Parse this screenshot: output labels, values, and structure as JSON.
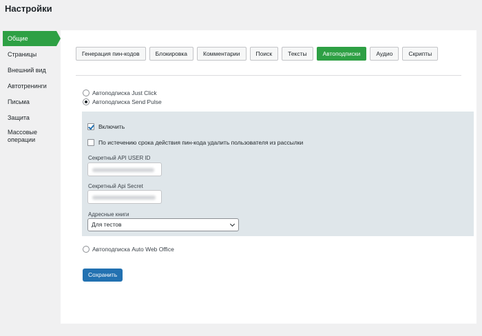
{
  "page": {
    "title": "Настройки"
  },
  "sidebar": {
    "items": [
      {
        "label": "Общие",
        "active": true
      },
      {
        "label": "Страницы"
      },
      {
        "label": "Внешний вид"
      },
      {
        "label": "Автотренинги"
      },
      {
        "label": "Письма"
      },
      {
        "label": "Защита"
      },
      {
        "label": "Массовые операции"
      }
    ]
  },
  "tabs": [
    {
      "label": "Генерация пин-кодов"
    },
    {
      "label": "Блокировка"
    },
    {
      "label": "Комментарии"
    },
    {
      "label": "Поиск"
    },
    {
      "label": "Тексты"
    },
    {
      "label": "Автоподписки",
      "active": true
    },
    {
      "label": "Аудио"
    },
    {
      "label": "Скрипты"
    }
  ],
  "options": {
    "justclick": {
      "label": "Автоподписка Just Click",
      "checked": false
    },
    "sendpulse": {
      "label": "Автоподписка Send Pulse",
      "checked": true
    },
    "autowebofis": {
      "label": "Автоподписка Auto Web Office",
      "checked": false
    }
  },
  "sendpulse_settings": {
    "enable": {
      "label": "Включить",
      "checked": true
    },
    "remove_on_expire": {
      "label": "По истечению срока действия пин-кода удалить пользователя из рассылки",
      "checked": false
    },
    "api_user_id": {
      "label": "Секретный API USER ID"
    },
    "api_secret": {
      "label": "Секретный Api Secret"
    },
    "address_books": {
      "label": "Адресные книги",
      "selected": "Для тестов"
    }
  },
  "buttons": {
    "save": "Сохранить"
  },
  "colors": {
    "accent_green": "#2ea044",
    "primary_blue": "#2271b1",
    "box_bg": "#dfe6ea"
  }
}
